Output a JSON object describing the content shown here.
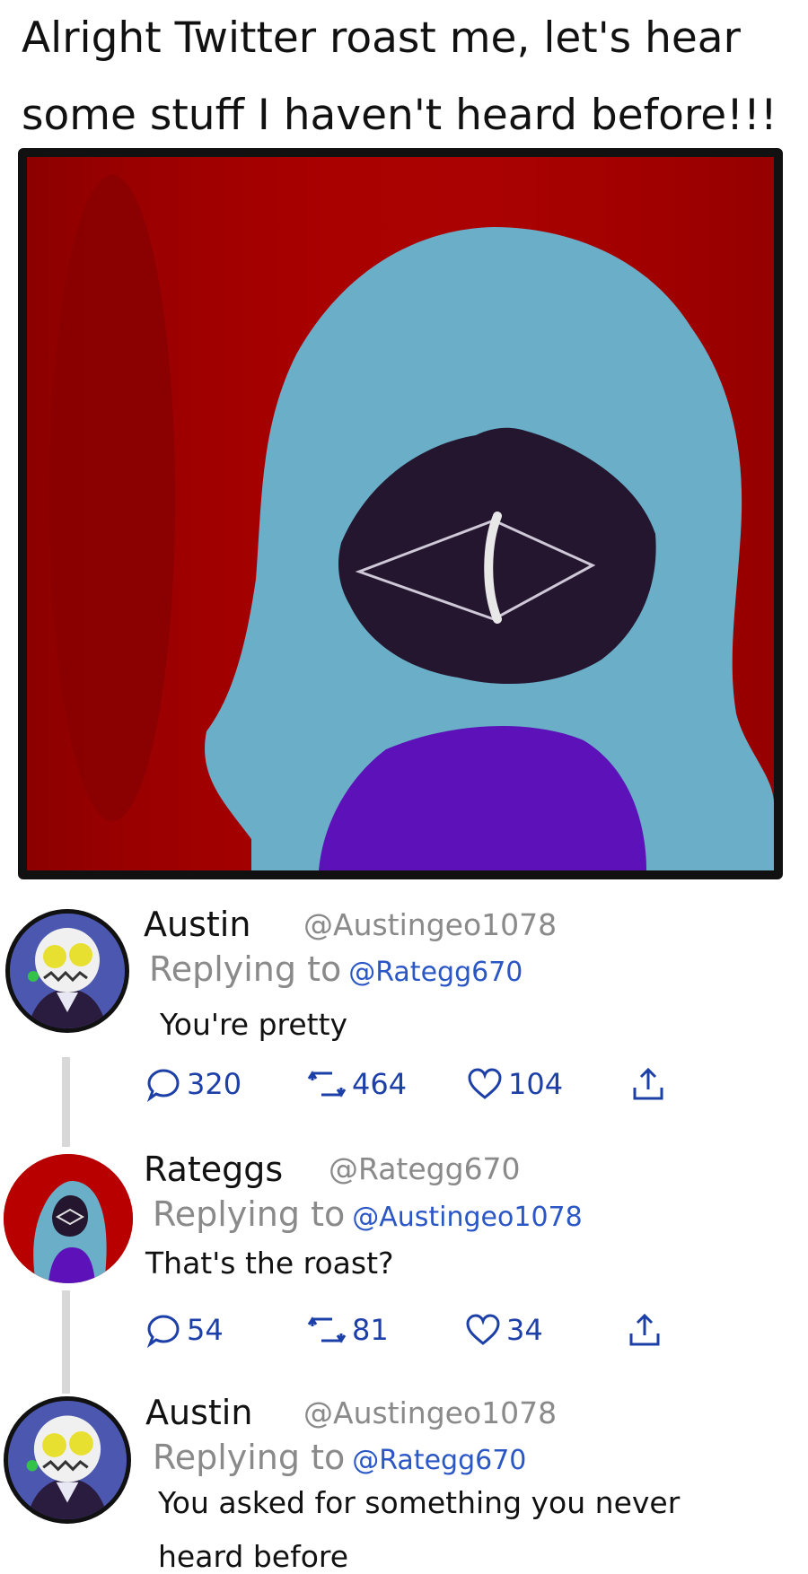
{
  "caption": {
    "line1": "Alright Twitter roast me, let's hear",
    "line2": "some stuff I haven't heard before!!!"
  },
  "colors": {
    "background_red": "#a90000",
    "hair": "#6aaec8",
    "face": "#24162e",
    "sweater": "#5c12b8",
    "mention_blue": "#2a56c6",
    "action_blue": "#1d3fa8",
    "thread_gray": "#d8d8d8"
  },
  "tweets": [
    {
      "name": "Austin",
      "handle": "@Austingeo1078",
      "replying_prefix": "Replying to",
      "replying_to": "@Rategg670",
      "text": "You're pretty",
      "avatar_icon": "skull-avatar-icon",
      "replies": "320",
      "retweets": "464",
      "likes": "104"
    },
    {
      "name": "Rateggs",
      "handle": "@Rategg670",
      "replying_prefix": "Replying to",
      "replying_to": "@Austingeo1078",
      "text": "That's the roast?",
      "avatar_icon": "hooded-avatar-icon",
      "replies": "54",
      "retweets": "81",
      "likes": "34"
    },
    {
      "name": "Austin",
      "handle": "@Austingeo1078",
      "replying_prefix": "Replying to",
      "replying_to": "@Rategg670",
      "text_line1": "You asked for something you never",
      "text_line2": "heard before",
      "avatar_icon": "skull-avatar-icon"
    }
  ]
}
